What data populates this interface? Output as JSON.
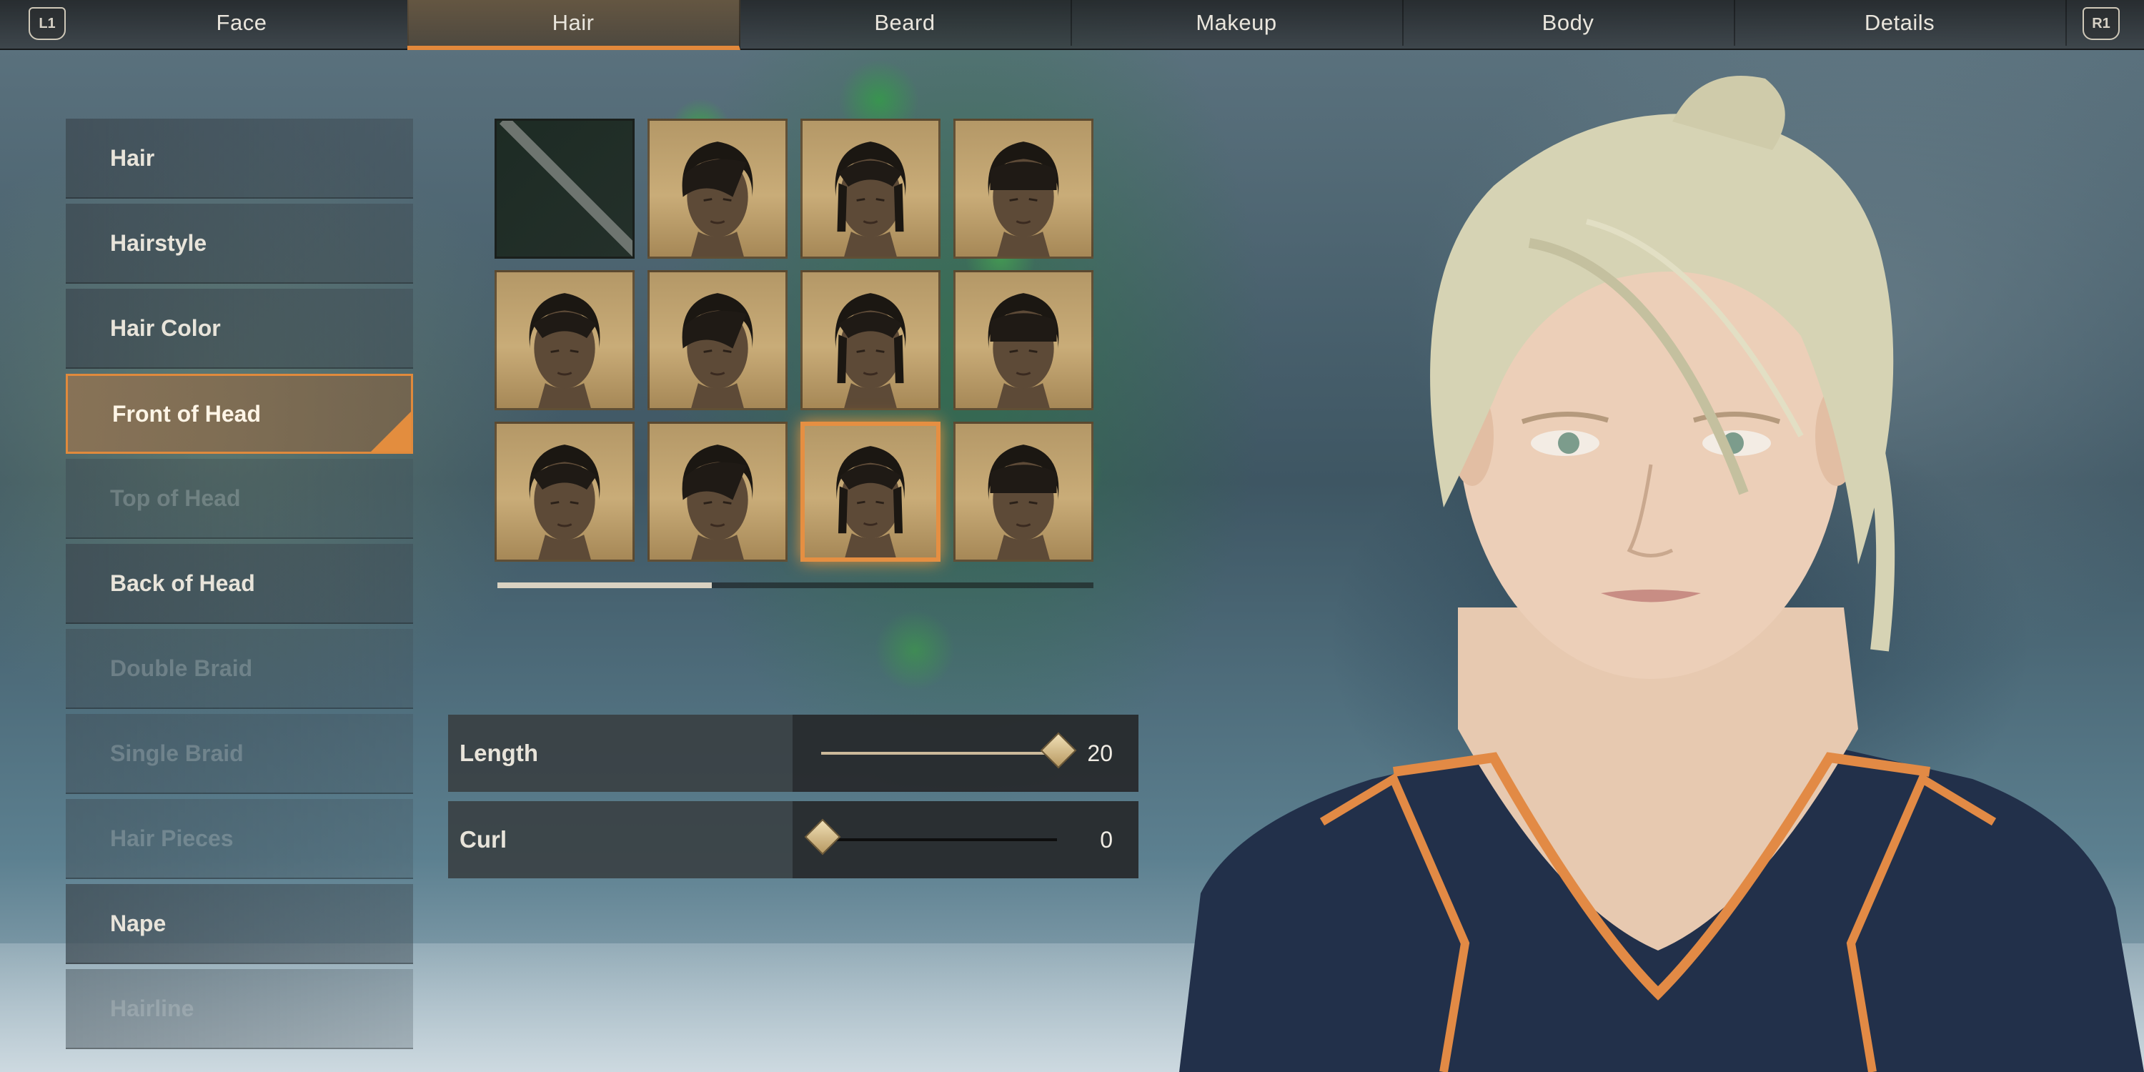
{
  "shoulder_left": "L1",
  "shoulder_right": "R1",
  "tabs": [
    {
      "label": "Face",
      "active": false
    },
    {
      "label": "Hair",
      "active": true
    },
    {
      "label": "Beard",
      "active": false
    },
    {
      "label": "Makeup",
      "active": false
    },
    {
      "label": "Body",
      "active": false
    },
    {
      "label": "Details",
      "active": false
    }
  ],
  "menu": [
    {
      "label": "Hair",
      "state": "normal"
    },
    {
      "label": "Hairstyle",
      "state": "normal"
    },
    {
      "label": "Hair Color",
      "state": "normal"
    },
    {
      "label": "Front of Head",
      "state": "selected"
    },
    {
      "label": "Top of Head",
      "state": "disabled"
    },
    {
      "label": "Back of Head",
      "state": "normal"
    },
    {
      "label": "Double Braid",
      "state": "disabled"
    },
    {
      "label": "Single Braid",
      "state": "disabled"
    },
    {
      "label": "Hair Pieces",
      "state": "disabled"
    },
    {
      "label": "Nape",
      "state": "normal"
    },
    {
      "label": "Hairline",
      "state": "disabled"
    }
  ],
  "hairstyle_grid": {
    "columns": 4,
    "rows": 3,
    "selected_index": 10,
    "scroll_fraction": 0.36
  },
  "sliders": [
    {
      "label": "Length",
      "value": "20",
      "fraction": 1.0
    },
    {
      "label": "Curl",
      "value": "0",
      "fraction": 0.0
    }
  ],
  "colors": {
    "accent": "#e58f42",
    "tab_bar": "#2e3033",
    "menu_bg": "#3c4850"
  }
}
